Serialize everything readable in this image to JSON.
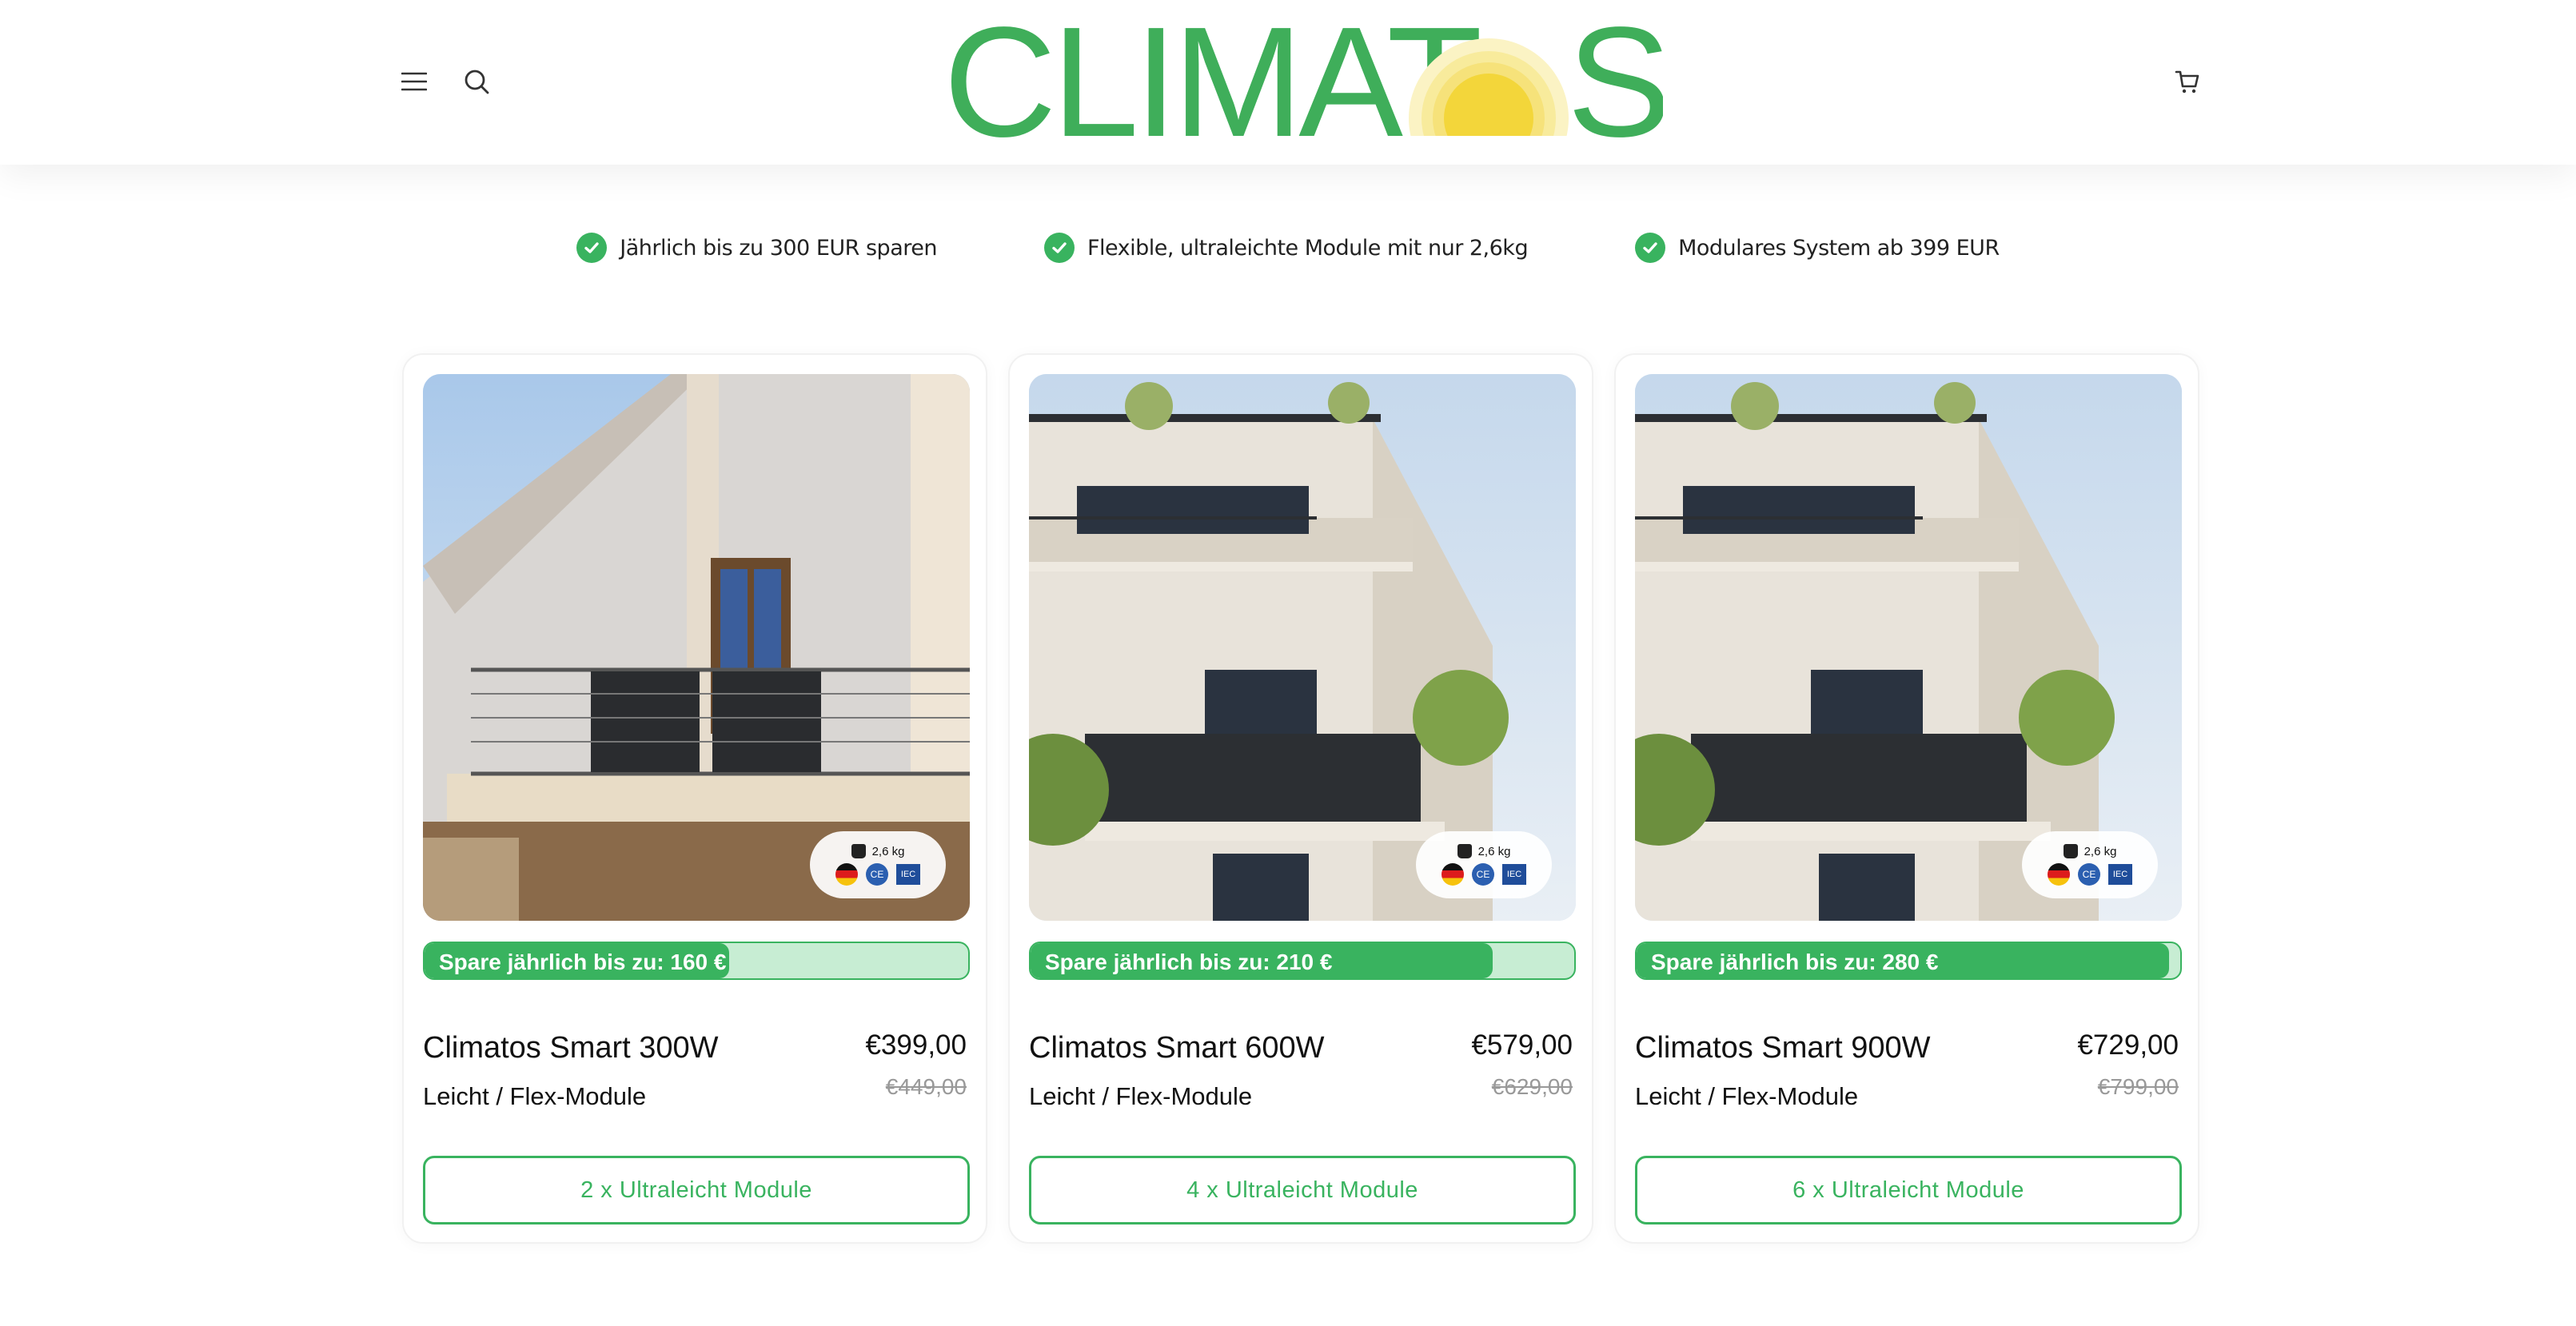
{
  "header": {
    "logo_text": "CLIMAT",
    "logo_text_end": "S",
    "menu_icon": "hamburger-menu-icon",
    "search_icon": "search-icon",
    "cart_icon": "cart-icon",
    "brand_green": "#3fae5a",
    "sun_yellow": "#f3d63a"
  },
  "features": [
    {
      "label": "Jährlich bis zu 300 EUR sparen"
    },
    {
      "label": "Flexible, ultraleichte Module mit nur 2,6kg"
    },
    {
      "label": "Modulares System ab 399 EUR"
    }
  ],
  "products": [
    {
      "badge_weight": "2,6 kg",
      "savings_label": "Spare jährlich bis zu: 160 €",
      "savings_fraction": 0.56,
      "title": "Climatos Smart 300W",
      "subtitle": "Leicht / Flex-Module",
      "price": "€399,00",
      "old_price": "€449,00",
      "cta": "2 x Ultraleicht Module"
    },
    {
      "badge_weight": "2,6 kg",
      "savings_label": "Spare jährlich bis zu: 210 €",
      "savings_fraction": 0.85,
      "title": "Climatos Smart 600W",
      "subtitle": "Leicht / Flex-Module",
      "price": "€579,00",
      "old_price": "€629,00",
      "cta": "4 x Ultraleicht Module"
    },
    {
      "badge_weight": "2,6 kg",
      "savings_label": "Spare jährlich bis zu: 280 €",
      "savings_fraction": 0.98,
      "title": "Climatos Smart 900W",
      "subtitle": "Leicht / Flex-Module",
      "price": "€729,00",
      "old_price": "€799,00",
      "cta": "6 x Ultraleicht Module"
    }
  ],
  "colors": {
    "accent": "#39b35f",
    "accent_light": "#c7edd3"
  }
}
